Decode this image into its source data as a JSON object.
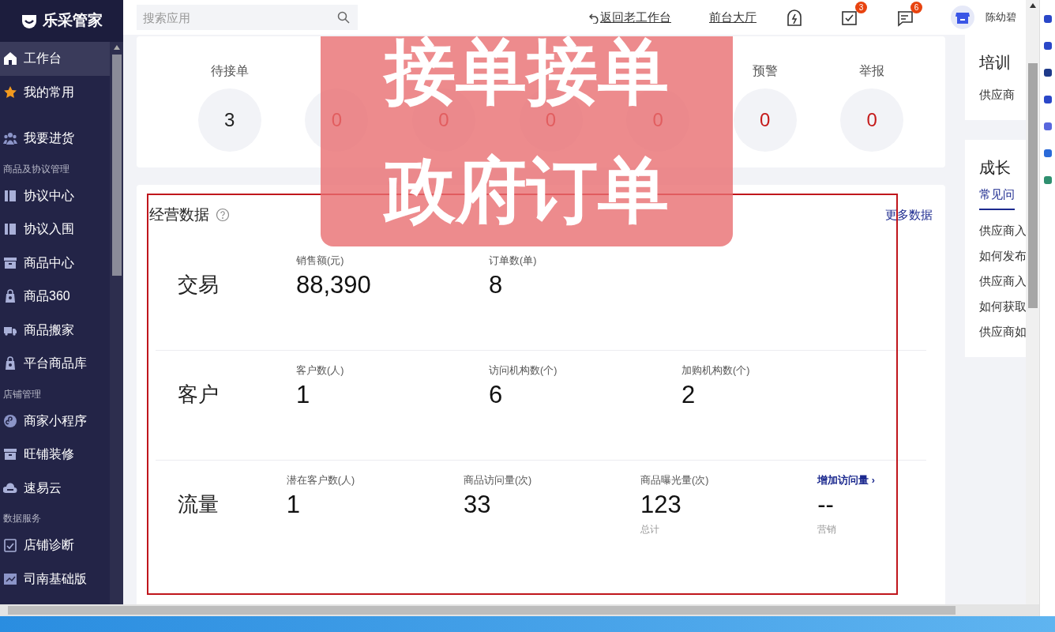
{
  "brand": {
    "name": "乐采管家"
  },
  "sidebar": {
    "items": [
      {
        "kind": "item",
        "label": "工作台",
        "selected": true
      },
      {
        "kind": "item",
        "label": "我的常用",
        "selected": false
      },
      {
        "kind": "item",
        "label": "我要进货",
        "selected": false
      },
      {
        "kind": "section",
        "label": "商品及协议管理"
      },
      {
        "kind": "item",
        "label": "协议中心",
        "selected": false
      },
      {
        "kind": "item",
        "label": "协议入围",
        "selected": false
      },
      {
        "kind": "item",
        "label": "商品中心",
        "selected": false
      },
      {
        "kind": "item",
        "label": "商品360",
        "selected": false
      },
      {
        "kind": "item",
        "label": "商品搬家",
        "selected": false
      },
      {
        "kind": "item",
        "label": "平台商品库",
        "selected": false
      },
      {
        "kind": "section",
        "label": "店铺管理"
      },
      {
        "kind": "item",
        "label": "商家小程序",
        "selected": false
      },
      {
        "kind": "item",
        "label": "旺铺装修",
        "selected": false
      },
      {
        "kind": "item",
        "label": "速易云",
        "selected": false
      },
      {
        "kind": "section",
        "label": "数据服务"
      },
      {
        "kind": "item",
        "label": "店铺诊断",
        "selected": false
      },
      {
        "kind": "item",
        "label": "司南基础版",
        "selected": false
      }
    ]
  },
  "topbar": {
    "search": {
      "placeholder": "搜索应用"
    },
    "back_link": "返回老工作台",
    "hall_link": "前台大厅",
    "task_badge": "3",
    "message_badge": "6",
    "user": "陈幼碧"
  },
  "stats": [
    {
      "label": "待接单",
      "value": "3",
      "alert": false
    },
    {
      "value": "0",
      "alert": true
    },
    {
      "value": "0",
      "alert": true
    },
    {
      "value": "0",
      "alert": true
    },
    {
      "value": "0",
      "alert": true
    },
    {
      "label": "预警",
      "value": "0",
      "alert": true
    },
    {
      "label": "举报",
      "value": "0",
      "alert": true
    }
  ],
  "business": {
    "title": "经营数据",
    "more_link": "更多数据",
    "rows": [
      {
        "label": "交易",
        "metrics": [
          {
            "kind": "stat",
            "label": "销售额(元)",
            "value": "88,390"
          },
          {
            "kind": "stat",
            "label": "订单数(单)",
            "value": "8"
          }
        ]
      },
      {
        "label": "客户",
        "metrics": [
          {
            "kind": "stat",
            "label": "客户数(人)",
            "value": "1"
          },
          {
            "kind": "stat",
            "label": "访问机构数(个)",
            "value": "6"
          },
          {
            "kind": "stat",
            "label": "加购机构数(个)",
            "value": "2"
          }
        ]
      },
      {
        "label": "流量",
        "metrics": [
          {
            "kind": "stat",
            "label": "潜在客户数(人)",
            "value": "1"
          },
          {
            "kind": "stat",
            "label": "商品访问量(次)",
            "value": "33"
          },
          {
            "kind": "stat",
            "label": "商品曝光量(次)",
            "value": "123",
            "sub": "总计"
          },
          {
            "kind": "link",
            "label": "增加访问量 ›",
            "value": "--",
            "sub": "营销"
          }
        ]
      }
    ]
  },
  "right_panel": {
    "training": {
      "title": "培训",
      "item": "供应商"
    },
    "growth": {
      "title": "成长",
      "tab": "常见问",
      "items": [
        "供应商入",
        "如何发布",
        "供应商入",
        "如何获取",
        "供应商如"
      ]
    }
  },
  "overlay_caption": {
    "lines": [
      "接单接单",
      "政府订单"
    ]
  }
}
